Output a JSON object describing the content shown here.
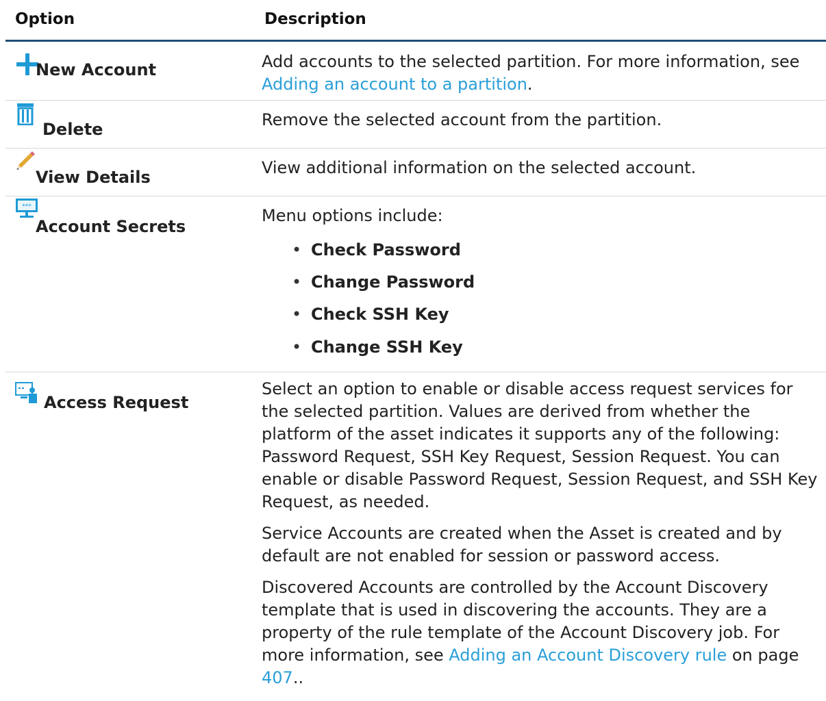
{
  "table": {
    "header": {
      "option": "Option",
      "description": "Description"
    },
    "rows": [
      {
        "option": "New Account",
        "icon": "plus-icon",
        "desc_text": "Add accounts to the selected partition. For more information, see ",
        "desc_link": "Adding an account to a partition",
        "desc_after": "."
      },
      {
        "option": "Delete",
        "icon": "trash-icon",
        "desc_text": "Remove the selected account from the partition."
      },
      {
        "option": "View Details",
        "icon": "pencil-icon",
        "desc_text": "View additional information on the selected account."
      },
      {
        "option": "Account Secrets",
        "icon": "monitor-password-icon",
        "desc_text": "Menu options include:",
        "menu_items": [
          "Check Password",
          "Change Password",
          "Check SSH Key",
          "Change SSH Key"
        ]
      },
      {
        "option": "Access Request",
        "icon": "access-request-icon",
        "paragraphs": [
          "Select an option to enable or disable access request services for the selected partition. Values are derived from whether the platform of the asset indicates it supports any of the following: Password Request, SSH Key Request, Session Request. You can enable or disable Password Request, Session Request, and SSH Key Request, as needed.",
          "Service Accounts are created when the Asset is created and by default are not enabled for session or password access."
        ],
        "last_text": "Discovered Accounts are controlled by the Account Discovery template that is used in discovering the accounts. They are a property of the rule template of the Account Discovery job. For more information, see ",
        "last_link": "Adding an Account Discovery rule",
        "last_mid": " on page ",
        "last_page": "407",
        "last_after": ".."
      }
    ]
  },
  "colors": {
    "accent": "#2a9fd8",
    "header_rule": "#1f4e79",
    "icon_blue": "#1e9ad6"
  }
}
